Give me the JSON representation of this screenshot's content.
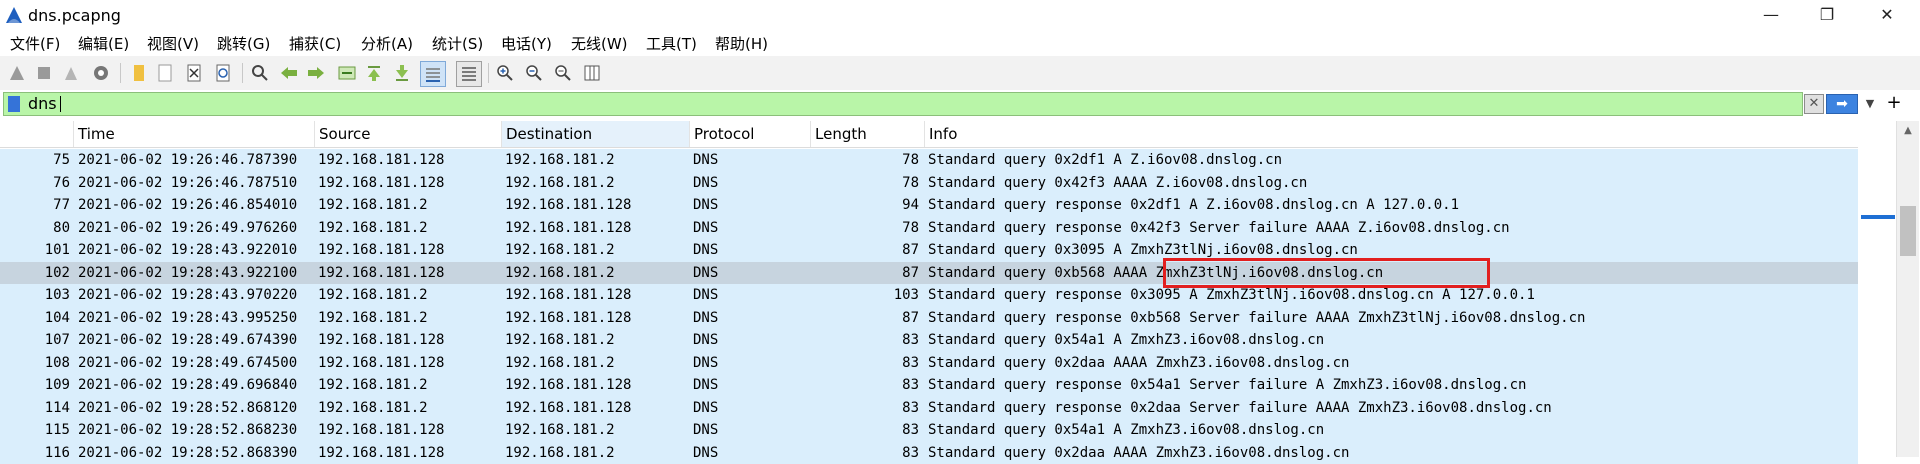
{
  "window": {
    "title": "dns.pcapng",
    "minimize": "—",
    "maximize": "❐",
    "close": "✕"
  },
  "menu": [
    "文件(F)",
    "编辑(E)",
    "视图(V)",
    "跳转(G)",
    "捕获(C)",
    "分析(A)",
    "统计(S)",
    "电话(Y)",
    "无线(W)",
    "工具(T)",
    "帮助(H)"
  ],
  "toolbar_icons": [
    "start-capture-icon",
    "stop-capture-icon",
    "restart-capture-icon",
    "capture-options-icon",
    "open-file-icon",
    "save-file-icon",
    "close-file-icon",
    "reload-file-icon",
    "find-packet-icon",
    "go-back-icon",
    "go-forward-icon",
    "go-to-packet-icon",
    "go-first-icon",
    "go-last-icon",
    "autoscroll-icon",
    "colorize-icon",
    "zoom-in-icon",
    "zoom-out-icon",
    "normal-size-icon",
    "resize-columns-icon"
  ],
  "filter": {
    "value": "dns",
    "background": "#b9f5a8"
  },
  "columns": [
    "Time",
    "Source",
    "Destination",
    "Protocol",
    "Length",
    "Info"
  ],
  "packets": [
    {
      "no": "75",
      "time": "2021-06-02 19:26:46.787390",
      "src": "192.168.181.128",
      "dst": "192.168.181.2",
      "proto": "DNS",
      "len": "78",
      "info": "Standard query 0x2df1 A Z.i6ov08.dnslog.cn"
    },
    {
      "no": "76",
      "time": "2021-06-02 19:26:46.787510",
      "src": "192.168.181.128",
      "dst": "192.168.181.2",
      "proto": "DNS",
      "len": "78",
      "info": "Standard query 0x42f3 AAAA Z.i6ov08.dnslog.cn"
    },
    {
      "no": "77",
      "time": "2021-06-02 19:26:46.854010",
      "src": "192.168.181.2",
      "dst": "192.168.181.128",
      "proto": "DNS",
      "len": "94",
      "info": "Standard query response 0x2df1 A Z.i6ov08.dnslog.cn A 127.0.0.1"
    },
    {
      "no": "80",
      "time": "2021-06-02 19:26:49.976260",
      "src": "192.168.181.2",
      "dst": "192.168.181.128",
      "proto": "DNS",
      "len": "78",
      "info": "Standard query response 0x42f3 Server failure AAAA Z.i6ov08.dnslog.cn"
    },
    {
      "no": "101",
      "time": "2021-06-02 19:28:43.922010",
      "src": "192.168.181.128",
      "dst": "192.168.181.2",
      "proto": "DNS",
      "len": "87",
      "info": "Standard query 0x3095 A ZmxhZ3tlNj.i6ov08.dnslog.cn"
    },
    {
      "no": "102",
      "time": "2021-06-02 19:28:43.922100",
      "src": "192.168.181.128",
      "dst": "192.168.181.2",
      "proto": "DNS",
      "len": "87",
      "info": "Standard query 0xb568 AAAA ZmxhZ3tlNj.i6ov08.dnslog.cn",
      "selected": true
    },
    {
      "no": "103",
      "time": "2021-06-02 19:28:43.970220",
      "src": "192.168.181.2",
      "dst": "192.168.181.128",
      "proto": "DNS",
      "len": "103",
      "info": "Standard query response 0x3095 A ZmxhZ3tlNj.i6ov08.dnslog.cn A 127.0.0.1"
    },
    {
      "no": "104",
      "time": "2021-06-02 19:28:43.995250",
      "src": "192.168.181.2",
      "dst": "192.168.181.128",
      "proto": "DNS",
      "len": "87",
      "info": "Standard query response 0xb568 Server failure AAAA ZmxhZ3tlNj.i6ov08.dnslog.cn"
    },
    {
      "no": "107",
      "time": "2021-06-02 19:28:49.674390",
      "src": "192.168.181.128",
      "dst": "192.168.181.2",
      "proto": "DNS",
      "len": "83",
      "info": "Standard query 0x54a1 A ZmxhZ3.i6ov08.dnslog.cn"
    },
    {
      "no": "108",
      "time": "2021-06-02 19:28:49.674500",
      "src": "192.168.181.128",
      "dst": "192.168.181.2",
      "proto": "DNS",
      "len": "83",
      "info": "Standard query 0x2daa AAAA ZmxhZ3.i6ov08.dnslog.cn"
    },
    {
      "no": "109",
      "time": "2021-06-02 19:28:49.696840",
      "src": "192.168.181.2",
      "dst": "192.168.181.128",
      "proto": "DNS",
      "len": "83",
      "info": "Standard query response 0x54a1 Server failure A ZmxhZ3.i6ov08.dnslog.cn"
    },
    {
      "no": "114",
      "time": "2021-06-02 19:28:52.868120",
      "src": "192.168.181.2",
      "dst": "192.168.181.128",
      "proto": "DNS",
      "len": "83",
      "info": "Standard query response 0x2daa Server failure AAAA ZmxhZ3.i6ov08.dnslog.cn"
    },
    {
      "no": "115",
      "time": "2021-06-02 19:28:52.868230",
      "src": "192.168.181.128",
      "dst": "192.168.181.2",
      "proto": "DNS",
      "len": "83",
      "info": "Standard query 0x54a1 A ZmxhZ3.i6ov08.dnslog.cn"
    },
    {
      "no": "116",
      "time": "2021-06-02 19:28:52.868390",
      "src": "192.168.181.128",
      "dst": "192.168.181.2",
      "proto": "DNS",
      "len": "83",
      "info": "Standard query 0x2daa AAAA ZmxhZ3.i6ov08.dnslog.cn"
    }
  ],
  "colors": {
    "row_bg": "#daeefc",
    "selected_bg": "#c7d4df",
    "highlight_border": "#e21f1f"
  }
}
